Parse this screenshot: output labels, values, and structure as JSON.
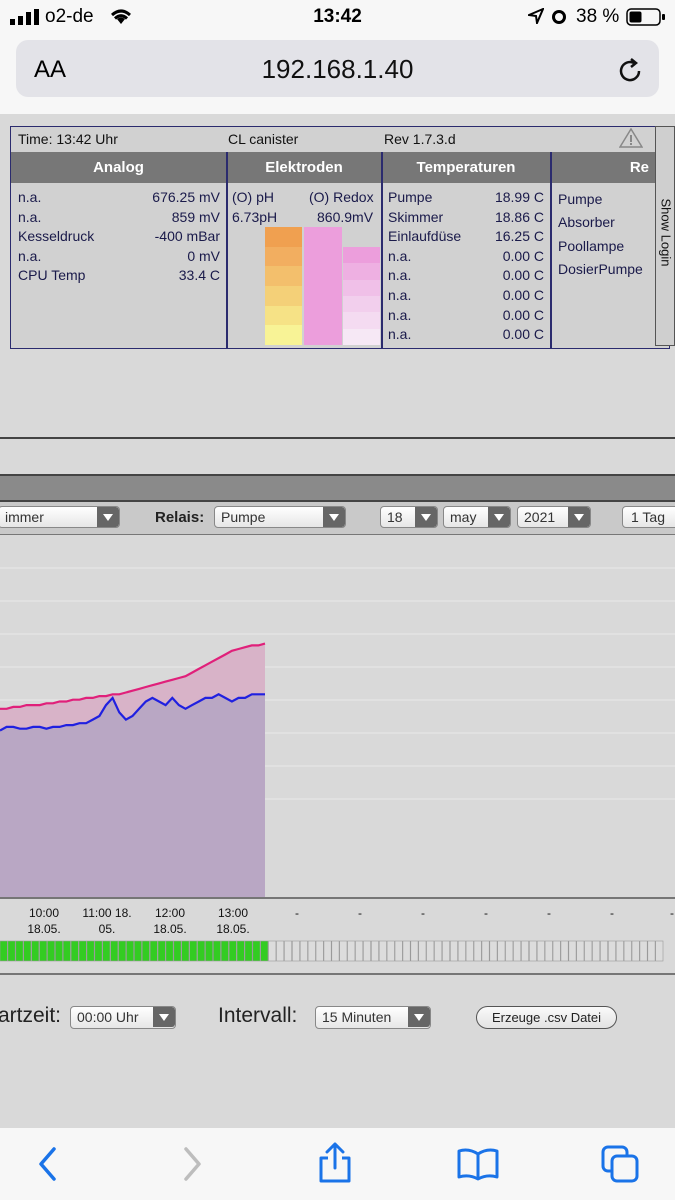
{
  "ios": {
    "carrier": "o2-de",
    "time": "13:42",
    "battery": "38 %",
    "aa": "AA",
    "url": "192.168.1.40"
  },
  "status": {
    "time_label": "Time: 13:42 Uhr",
    "device": "CL canister",
    "rev": "Rev 1.7.3.d"
  },
  "columns": {
    "analog": "Analog",
    "elektroden": "Elektroden",
    "temperaturen": "Temperaturen",
    "relais": "Re"
  },
  "analog_rows": [
    {
      "name": "n.a.",
      "value": "676.25 mV"
    },
    {
      "name": "n.a.",
      "value": "859 mV"
    },
    {
      "name": "Kesseldruck",
      "value": "-400 mBar"
    },
    {
      "name": "n.a.",
      "value": "0 mV"
    },
    {
      "name": "CPU Temp",
      "value": "33.4 C"
    }
  ],
  "elektroden": {
    "ph_label": "(O) pH",
    "redox_label": "(O) Redox",
    "ph_value": "6.73pH",
    "redox_value": "860.9mV",
    "ph_colors": [
      "#f0a050",
      "#f2ae60",
      "#f3bf6c",
      "#f4d078",
      "#f6e286",
      "#f8f396"
    ],
    "redox_colors": [
      "#ec9edc",
      "#eeb0e2",
      "#f0c0e8",
      "#f2cfed",
      "#f4dbf1",
      "#f6e8f5"
    ]
  },
  "temp_rows": [
    {
      "name": "Pumpe",
      "value": "18.99 C"
    },
    {
      "name": "Skimmer",
      "value": "18.86 C"
    },
    {
      "name": "Einlaufdüse",
      "value": "16.25 C"
    },
    {
      "name": "n.a.",
      "value": "0.00 C"
    },
    {
      "name": "n.a.",
      "value": "0.00 C"
    },
    {
      "name": "n.a.",
      "value": "0.00 C"
    },
    {
      "name": "n.a.",
      "value": "0.00 C"
    },
    {
      "name": "n.a.",
      "value": "0.00 C"
    }
  ],
  "relais_rows": [
    "Pumpe",
    "Absorber",
    "Poollampe",
    "DosierPumpe"
  ],
  "show_login": "Show Login",
  "controls": {
    "sensor_select": "immer",
    "relais_label": "Relais:",
    "relais_select": "Pumpe",
    "day": "18",
    "month": "may",
    "year": "2021",
    "range": "1 Tag",
    "startzeit_label": "artzeit:",
    "startzeit_select": "00:00 Uhr",
    "intervall_label": "Intervall:",
    "intervall_select": "15 Minuten",
    "csv_button": "Erzeuge .csv Datei"
  },
  "colors": {
    "relay_on": "#33cc22",
    "relay_off": "#dcdcdc",
    "series_pink": "#e0207a",
    "series_blue": "#2020e0",
    "area_fill": "#b9a7c4"
  },
  "chart_data": {
    "type": "line",
    "x_tick_labels": [
      [
        "10:00",
        "18.05."
      ],
      [
        "11:00 18.",
        "05."
      ],
      [
        "12:00",
        "18.05."
      ],
      [
        "13:00",
        "18.05."
      ],
      [
        "-",
        ""
      ],
      [
        "-",
        ""
      ],
      [
        "-",
        ""
      ],
      [
        "-",
        ""
      ],
      [
        "-",
        ""
      ],
      [
        "-",
        ""
      ],
      [
        "-",
        ""
      ]
    ],
    "series": [
      {
        "values": [
          0.52,
          0.52,
          0.525,
          0.525,
          0.53,
          0.53,
          0.53,
          0.535,
          0.535,
          0.54,
          0.54,
          0.545,
          0.545,
          0.55,
          0.55,
          0.555,
          0.555,
          0.56,
          0.56,
          0.565,
          0.57,
          0.575,
          0.58,
          0.585,
          0.59,
          0.595,
          0.6,
          0.605,
          0.61,
          0.62,
          0.63,
          0.64,
          0.65,
          0.66,
          0.67,
          0.68,
          0.685,
          0.69,
          0.695,
          0.695,
          0.7
        ]
      },
      {
        "values": [
          0.46,
          0.47,
          0.47,
          0.465,
          0.465,
          0.47,
          0.47,
          0.465,
          0.47,
          0.47,
          0.475,
          0.475,
          0.48,
          0.48,
          0.49,
          0.5,
          0.53,
          0.55,
          0.51,
          0.49,
          0.5,
          0.52,
          0.54,
          0.55,
          0.54,
          0.53,
          0.55,
          0.53,
          0.52,
          0.53,
          0.54,
          0.55,
          0.55,
          0.56,
          0.55,
          0.54,
          0.55,
          0.55,
          0.56,
          0.56,
          0.56
        ]
      }
    ],
    "relay_states": [
      1,
      1,
      1,
      1,
      1,
      1,
      1,
      1,
      1,
      1,
      1,
      1,
      1,
      1,
      1,
      1,
      1,
      1,
      1,
      1,
      1,
      1,
      1,
      1,
      1,
      1,
      1,
      1,
      1,
      1,
      1,
      1,
      1,
      1,
      0,
      0,
      0,
      0,
      0,
      0,
      0,
      0,
      0,
      0,
      0,
      0,
      0,
      0,
      0,
      0,
      0,
      0,
      0,
      0,
      0,
      0,
      0,
      0,
      0,
      0,
      0,
      0,
      0,
      0,
      0,
      0,
      0,
      0,
      0,
      0,
      0,
      0,
      0,
      0,
      0,
      0,
      0,
      0,
      0,
      0,
      0,
      0,
      0,
      0
    ]
  }
}
